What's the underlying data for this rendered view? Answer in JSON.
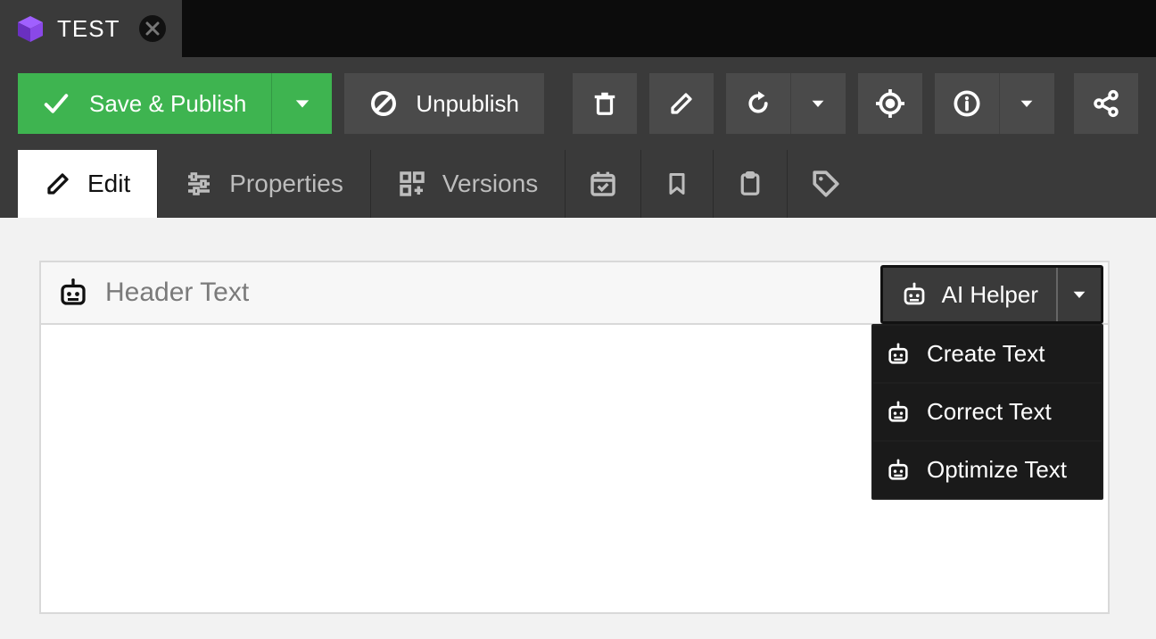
{
  "tab": {
    "title": "TEST"
  },
  "toolbar": {
    "save_label": "Save & Publish",
    "unpublish_label": "Unpublish"
  },
  "secondary_tabs": {
    "edit": "Edit",
    "properties": "Properties",
    "versions": "Versions"
  },
  "card": {
    "title": "Header Text"
  },
  "ai_helper": {
    "button_label": "AI Helper",
    "menu": {
      "create": "Create Text",
      "correct": "Correct Text",
      "optimize": "Optimize Text"
    }
  }
}
